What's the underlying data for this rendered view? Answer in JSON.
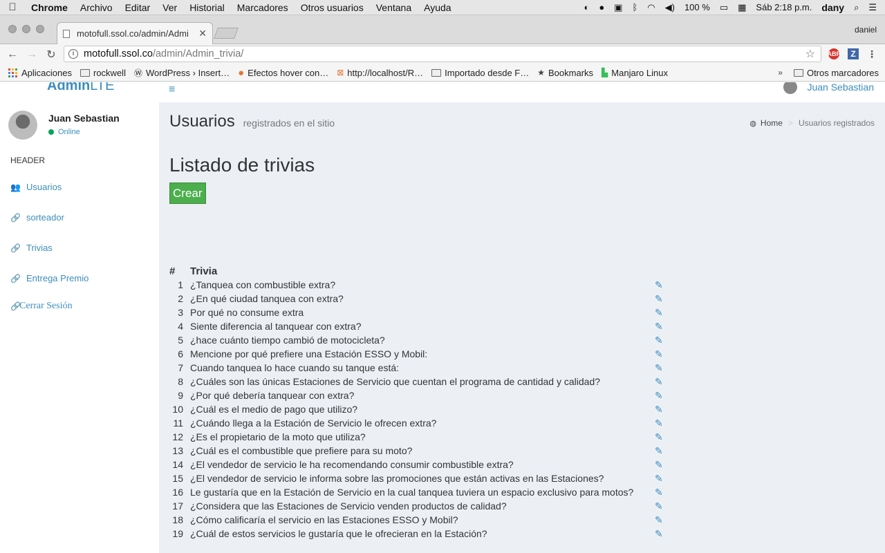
{
  "menubar": {
    "apple": "",
    "items": [
      "Chrome",
      "Archivo",
      "Editar",
      "Ver",
      "Historial",
      "Marcadores",
      "Otros usuarios",
      "Ventana",
      "Ayuda"
    ],
    "battery": "100 %",
    "clock": "Sáb 2:18 p.m.",
    "user": "dany"
  },
  "browser": {
    "tab_title": "motofull.ssol.co/admin/Admi",
    "profile": "daniel",
    "url_host": "motofull.ssol.co",
    "url_path": "/admin/Admin_trivia/",
    "ext_abp": "ABP",
    "ext_z": "Z"
  },
  "bookmarks": {
    "items": [
      "Aplicaciones",
      "rockwell",
      "WordPress › Insert…",
      "Efectos hover con…",
      "http://localhost/R…",
      "Importado desde F…",
      "Bookmarks",
      "Manjaro Linux"
    ],
    "other": "Otros marcadores",
    "chevron": "»"
  },
  "topnav": {
    "logo_bold": "Admin",
    "logo_light": "LTE",
    "user": "Juan Sebastian"
  },
  "sidebar": {
    "user_name": "Juan Sebastian",
    "status": "Online",
    "header": "HEADER",
    "items": [
      {
        "label": "Usuarios",
        "icon": "users-icon"
      },
      {
        "label": "sorteador",
        "icon": "link-icon"
      },
      {
        "label": "Trivias",
        "icon": "link-icon"
      },
      {
        "label": "Entrega Premio",
        "icon": "link-icon"
      },
      {
        "label": "Cerrar Sesión",
        "icon": "link-icon"
      }
    ]
  },
  "content": {
    "header_title": "Usuarios",
    "header_subtitle": "registrados en el sitio",
    "breadcrumb_home": "Home",
    "breadcrumb_active": "Usuarios registrados",
    "page_title": "Listado de trivias",
    "create_button": "Crear",
    "table_headers": [
      "#",
      "Trivia"
    ],
    "rows": [
      {
        "n": "1",
        "q": "¿Tanquea con combustible extra?"
      },
      {
        "n": "2",
        "q": "¿En qué ciudad tanquea con extra?"
      },
      {
        "n": "3",
        "q": "Por qué no consume extra"
      },
      {
        "n": "4",
        "q": "Siente diferencia al tanquear con extra?"
      },
      {
        "n": "5",
        "q": "¿hace cuánto tiempo cambió de motocicleta?"
      },
      {
        "n": "6",
        "q": "Mencione por qué prefiere una Estación ESSO y Mobil:"
      },
      {
        "n": "7",
        "q": "Cuando tanquea lo hace cuando su tanque está:"
      },
      {
        "n": "8",
        "q": "¿Cuáles son las únicas Estaciones de Servicio que cuentan el programa de cantidad y calidad?"
      },
      {
        "n": "9",
        "q": "¿Por qué debería tanquear con extra?"
      },
      {
        "n": "10",
        "q": "¿Cuál es el medio de pago que utilizo?"
      },
      {
        "n": "11",
        "q": "¿Cuándo llega a la Estación de Servicio le ofrecen extra?"
      },
      {
        "n": "12",
        "q": "¿Es el propietario de la moto que utiliza?"
      },
      {
        "n": "13",
        "q": "¿Cuál es el combustible que prefiere para su moto?"
      },
      {
        "n": "14",
        "q": "¿El vendedor de servicio le ha recomendando consumir combustible extra?"
      },
      {
        "n": "15",
        "q": "¿El vendedor de servicio le informa sobre las promociones que están activas en las Estaciones?"
      },
      {
        "n": "16",
        "q": "Le gustaría que en la Estación de Servicio en la cual tanquea tuviera un espacio exclusivo para motos?"
      },
      {
        "n": "17",
        "q": "¿Considera que las Estaciones de Servicio venden productos de calidad?"
      },
      {
        "n": "18",
        "q": "¿Cómo calificaría el servicio en las Estaciones ESSO y Mobil?"
      },
      {
        "n": "19",
        "q": "¿Cuál de estos servicios le gustaría que le ofrecieran en la Estación?"
      }
    ]
  },
  "colors": {
    "primary": "#3c8dbc",
    "success": "#4cae4c",
    "content_bg": "#ecf0f5",
    "online": "#00a65a"
  }
}
